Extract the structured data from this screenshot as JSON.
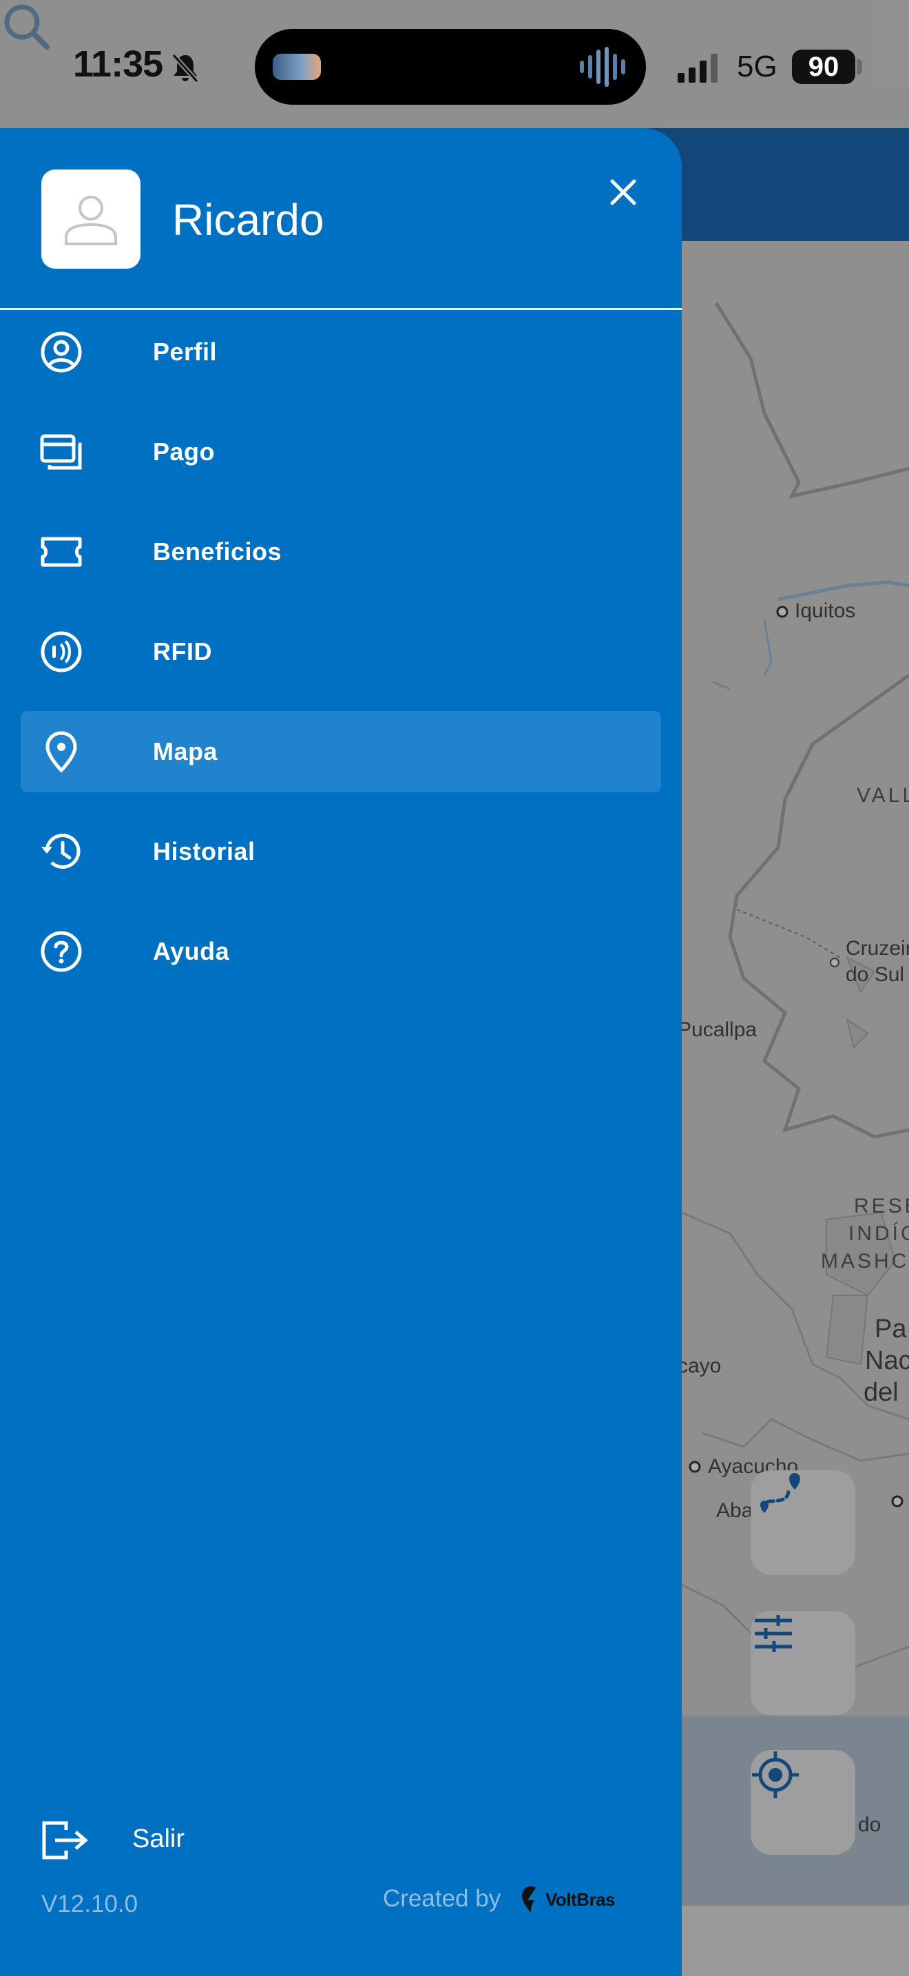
{
  "status_bar": {
    "time": "11:35",
    "network": "5G",
    "battery": "90"
  },
  "map": {
    "labels": [
      "Iquitos",
      "VALL",
      "Cruzeir",
      "do Sul",
      "Pucallpa",
      "RESE",
      "INDÍG",
      "MASHCO",
      "Pa",
      "Nac",
      "del",
      "cayo",
      "Ayacucho",
      "Aba",
      "do"
    ],
    "buttons": {
      "route": "route-icon",
      "filters": "sliders-icon",
      "locate": "crosshair-icon"
    }
  },
  "drawer": {
    "user_name": "Ricardo",
    "menu": [
      {
        "label": "Perfil",
        "icon": "user-circle-icon",
        "active": false
      },
      {
        "label": "Pago",
        "icon": "cards-icon",
        "active": false
      },
      {
        "label": "Beneficios",
        "icon": "ticket-icon",
        "active": false
      },
      {
        "label": "RFID",
        "icon": "rfid-icon",
        "active": false
      },
      {
        "label": "Mapa",
        "icon": "map-pin-icon",
        "active": true
      },
      {
        "label": "Historial",
        "icon": "history-icon",
        "active": false
      },
      {
        "label": "Ayuda",
        "icon": "help-icon",
        "active": false
      }
    ],
    "logout_label": "Salir",
    "version": "V12.10.0",
    "created_by": "Created by",
    "brand": "VoltBras"
  },
  "colors": {
    "drawer_bg": "#0070c2",
    "active_item": "#2183cd",
    "header_bar": "#1f6bb5"
  }
}
